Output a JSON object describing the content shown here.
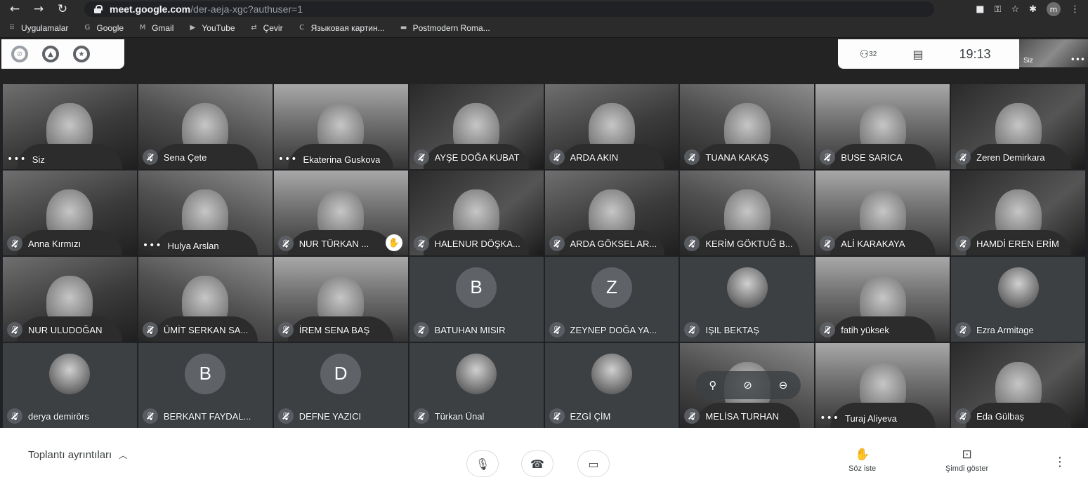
{
  "browser": {
    "url_host": "meet.google.com",
    "url_path": "/der-aeja-xgc?authuser=1",
    "profile_initial": "m",
    "bookmarks": [
      "Uygulamalar",
      "Google",
      "Gmail",
      "YouTube",
      "Çevir",
      "Языковая картин...",
      "Postmodern Roma..."
    ]
  },
  "meet_header": {
    "participant_count": "32",
    "clock": "19:13",
    "self_label": "Siz"
  },
  "tiles": [
    {
      "name": "Siz",
      "kind": "video",
      "badge": "more"
    },
    {
      "name": "Sena Çete",
      "kind": "video",
      "badge": "mute"
    },
    {
      "name": "Ekaterina Guskova",
      "kind": "video",
      "badge": "more"
    },
    {
      "name": "AYŞE DOĞA KUBAT",
      "kind": "video",
      "badge": "mute"
    },
    {
      "name": "ARDA AKIN",
      "kind": "video",
      "badge": "mute"
    },
    {
      "name": "TUANA KAKAŞ",
      "kind": "video",
      "badge": "mute"
    },
    {
      "name": "BUSE SARICA",
      "kind": "video",
      "badge": "mute"
    },
    {
      "name": "Zeren Demirkara",
      "kind": "video",
      "badge": "mute"
    },
    {
      "name": "Anna Kırmızı",
      "kind": "video",
      "badge": "mute"
    },
    {
      "name": "Hulya Arslan",
      "kind": "video",
      "badge": "more"
    },
    {
      "name": "NUR TÜRKAN ...",
      "kind": "video",
      "badge": "mute",
      "hand": true
    },
    {
      "name": "HALENUR DÖŞKA...",
      "kind": "video",
      "badge": "mute"
    },
    {
      "name": "ARDA GÖKSEL AR...",
      "kind": "video",
      "badge": "mute"
    },
    {
      "name": "KERİM GÖKTUĞ B...",
      "kind": "video",
      "badge": "mute"
    },
    {
      "name": "ALİ KARAKAYA",
      "kind": "video",
      "badge": "mute"
    },
    {
      "name": "HAMDİ EREN ERİM",
      "kind": "video",
      "badge": "mute"
    },
    {
      "name": "NUR ULUDOĞAN",
      "kind": "video",
      "badge": "mute"
    },
    {
      "name": "ÜMİT SERKAN SA...",
      "kind": "video",
      "badge": "mute"
    },
    {
      "name": "İREM SENA BAŞ",
      "kind": "video",
      "badge": "mute"
    },
    {
      "name": "BATUHAN MISIR",
      "kind": "avatar",
      "initial": "B",
      "badge": "mute"
    },
    {
      "name": "ZEYNEP DOĞA YA...",
      "kind": "avatar",
      "initial": "Z",
      "badge": "mute"
    },
    {
      "name": "IŞIL BEKTAŞ",
      "kind": "photo",
      "badge": "mute"
    },
    {
      "name": "fatih yüksek",
      "kind": "video",
      "badge": "mute"
    },
    {
      "name": "Ezra Armitage",
      "kind": "photo",
      "badge": "mute"
    },
    {
      "name": "derya demirörs",
      "kind": "photo",
      "badge": "mute"
    },
    {
      "name": "BERKANT FAYDAL...",
      "kind": "avatar",
      "initial": "B",
      "badge": "mute"
    },
    {
      "name": "DEFNE YAZICI",
      "kind": "avatar",
      "initial": "D",
      "badge": "mute"
    },
    {
      "name": "Türkan Ünal",
      "kind": "photo",
      "badge": "mute"
    },
    {
      "name": "EZGİ ÇİM",
      "kind": "photo",
      "badge": "mute"
    },
    {
      "name": "MELİSA TURHAN",
      "kind": "video",
      "badge": "mute",
      "hover": true
    },
    {
      "name": "Turaj Aliyeva",
      "kind": "video",
      "badge": "more"
    },
    {
      "name": "Eda Gülbaş",
      "kind": "video",
      "badge": "mute"
    }
  ],
  "bottom_bar": {
    "meeting_details": "Toplantı ayrıntıları",
    "raise_hand": "Söz iste",
    "present_now": "Şimdi göster"
  },
  "colors": {
    "background": "#202124",
    "bottom_bar": "#ffffff",
    "tile_empty": "#3c4043"
  }
}
